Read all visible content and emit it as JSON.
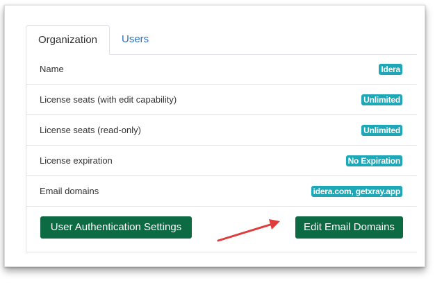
{
  "tabs": {
    "organization": "Organization",
    "users": "Users"
  },
  "rows": [
    {
      "label": "Name",
      "value": "Idera"
    },
    {
      "label": "License seats (with edit capability)",
      "value": "Unlimited"
    },
    {
      "label": "License seats (read-only)",
      "value": "Unlimited"
    },
    {
      "label": "License expiration",
      "value": "No Expiration"
    },
    {
      "label": "Email domains",
      "value": "idera.com, getxray.app"
    }
  ],
  "buttons": {
    "user_auth_settings": "User Authentication Settings",
    "edit_email_domains": "Edit Email Domains"
  },
  "colors": {
    "badge": "#1ea7b7",
    "button": "#0c6b43",
    "tab_link": "#2e6fc7",
    "annotation_arrow": "#e03c3c"
  }
}
